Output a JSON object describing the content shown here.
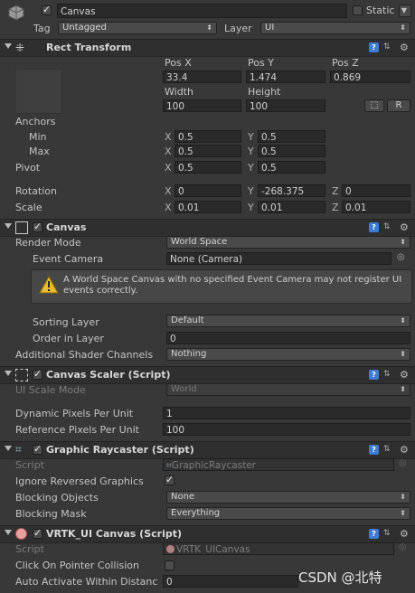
{
  "header": {
    "name": "Canvas",
    "static_label": "Static",
    "tag_label": "Tag",
    "tag_value": "Untagged",
    "layer_label": "Layer",
    "layer_value": "UI"
  },
  "rect_transform": {
    "title": "Rect Transform",
    "pos_x_label": "Pos X",
    "pos_y_label": "Pos Y",
    "pos_z_label": "Pos Z",
    "pos_x": "33.4",
    "pos_y": "1.474",
    "pos_z": "0.869",
    "width_label": "Width",
    "height_label": "Height",
    "width": "100",
    "height": "100",
    "r_label": "R",
    "anchors_label": "Anchors",
    "min_label": "Min",
    "max_label": "Max",
    "anchor_min_x": "0.5",
    "anchor_min_y": "0.5",
    "anchor_max_x": "0.5",
    "anchor_max_y": "0.5",
    "pivot_label": "Pivot",
    "pivot_x": "0.5",
    "pivot_y": "0.5",
    "rotation_label": "Rotation",
    "rot_x": "0",
    "rot_y": "-268.375",
    "rot_z": "0",
    "scale_label": "Scale",
    "scale_x": "0.01",
    "scale_y": "0.01",
    "scale_z": "0.01",
    "x": "X",
    "y": "Y",
    "z": "Z"
  },
  "canvas": {
    "title": "Canvas",
    "render_mode_label": "Render Mode",
    "render_mode": "World Space",
    "event_camera_label": "Event Camera",
    "event_camera": "None (Camera)",
    "warning": "A World Space Canvas with no specified Event Camera may not register UI events correctly.",
    "sorting_layer_label": "Sorting Layer",
    "sorting_layer": "Default",
    "order_label": "Order in Layer",
    "order": "0",
    "shader_label": "Additional Shader Channels",
    "shader": "Nothing"
  },
  "scaler": {
    "title": "Canvas Scaler (Script)",
    "ui_scale_label": "UI Scale Mode",
    "ui_scale": "World",
    "dynamic_label": "Dynamic Pixels Per Unit",
    "dynamic": "1",
    "reference_label": "Reference Pixels Per Unit",
    "reference": "100"
  },
  "raycaster": {
    "title": "Graphic Raycaster (Script)",
    "script_label": "Script",
    "script": "GraphicRaycaster",
    "ignore_label": "Ignore Reversed Graphics",
    "blocking_objects_label": "Blocking Objects",
    "blocking_objects": "None",
    "blocking_mask_label": "Blocking Mask",
    "blocking_mask": "Everything"
  },
  "vrtk": {
    "title": "VRTK_UI Canvas (Script)",
    "script_label": "Script",
    "script": "VRTK_UICanvas",
    "click_label": "Click On Pointer Collision",
    "auto_label": "Auto Activate Within Distanc",
    "auto_value": "0"
  },
  "watermark": "CSDN @北特"
}
